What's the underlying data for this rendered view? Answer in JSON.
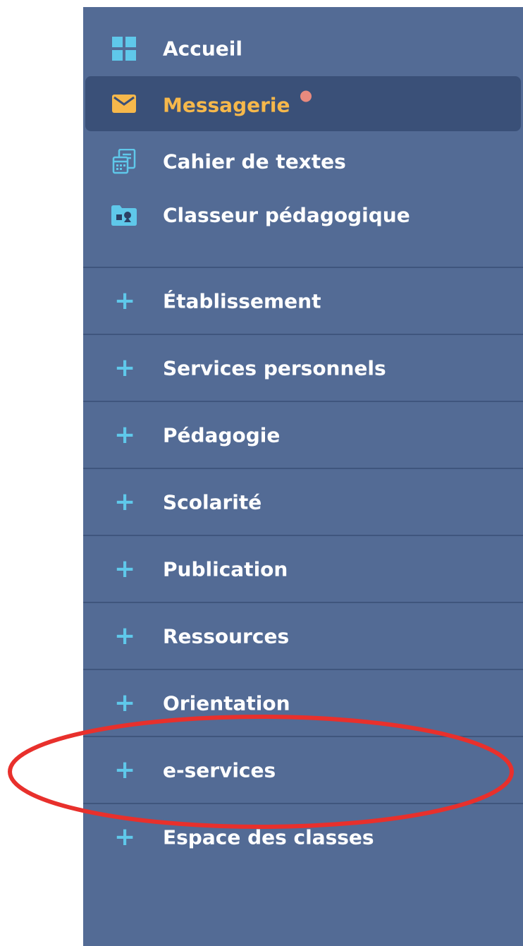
{
  "sidebar": {
    "top_items": [
      {
        "label": "Accueil",
        "icon": "dashboard-grid-icon",
        "active": false
      },
      {
        "label": "Messagerie",
        "icon": "envelope-icon",
        "active": true,
        "badge_color": "#e88a7e"
      },
      {
        "label": "Cahier de textes",
        "icon": "calendar-notebook-icon",
        "active": false
      },
      {
        "label": "Classeur pédagogique",
        "icon": "folder-shapes-icon",
        "active": false
      }
    ],
    "sections": [
      {
        "label": "Établissement",
        "icon": "plus-icon"
      },
      {
        "label": "Services personnels",
        "icon": "plus-icon"
      },
      {
        "label": "Pédagogie",
        "icon": "plus-icon"
      },
      {
        "label": "Scolarité",
        "icon": "plus-icon"
      },
      {
        "label": "Publication",
        "icon": "plus-icon"
      },
      {
        "label": "Ressources",
        "icon": "plus-icon"
      },
      {
        "label": "Orientation",
        "icon": "plus-icon"
      },
      {
        "label": "e-services",
        "icon": "plus-icon",
        "highlighted": true
      },
      {
        "label": "Espace des classes",
        "icon": "plus-icon"
      }
    ],
    "plus_glyph": "+"
  },
  "colors": {
    "sidebar_bg": "#536b95",
    "active_bg": "#3a5078",
    "active_text": "#f6b84b",
    "icon_blue": "#5fc8ea",
    "annotation_red": "#e8302c"
  }
}
